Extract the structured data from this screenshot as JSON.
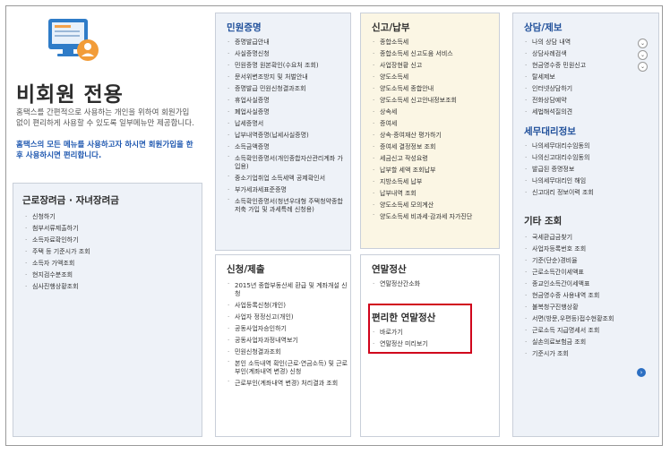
{
  "hero": {
    "title": "비회원 전용",
    "desc": "홈택스를 간편적으로 사용하는 개인을 위하여 회원가입 없이 편리하게 사용할 수 있도록 일부메뉴만 제공합니다.",
    "desc_link": "홈택스의 모든 메뉴를 사용하고자 하시면 회원가입을 한 후 사용하시면 편리합니다.",
    "icon": "computer-person-icon"
  },
  "earned": {
    "title": "근로장려금 · 자녀장려금",
    "items": [
      "신청하기",
      "첨부서류제출하기",
      "소득자료확인하기",
      "주택 등 기준시가 조회",
      "소득자 가액조회",
      "현지검수분조회",
      "심사진행상황조회"
    ]
  },
  "civil": {
    "title": "민원증명",
    "items": [
      "증명발급안내",
      "사실증명신청",
      "민원증명 원본확인(수요처 조회)",
      "문서위변조방지 및 처벌안내",
      "증명발급 민원신청결과조회",
      "휴업사실증명",
      "폐업사실증명",
      "납세증명서",
      "납부내역증명(납세사실증명)",
      "소득금액증명",
      "소득확인증명서(개인종합자산관리계좌 가입용)",
      "중소기업취업 소득세액 공제확인서",
      "부가세과세표준증명",
      "소득확인증명서(청년우대형 주택청약종합저축 가입 및 과세특례 신청용)"
    ]
  },
  "apply": {
    "title": "신청/제출",
    "items": [
      "2015년 종합부동산세 환급 및 계좌개설 신청",
      "사업등록신청(개인)",
      "사업자 정정신고(개인)",
      "공동사업자승인하기",
      "공동사업자과정내역보기",
      "민원신청결과조회",
      "본인 소득내역 확인(근로·연금소득) 및 근로부인(계좌내역 변경) 신청",
      "근로부인(계좌내역 변경) 처리결과 조회"
    ]
  },
  "report": {
    "title": "신고/납부",
    "items": [
      "종합소득세",
      "종합소득세 신고도움 서비스",
      "사업장현황 신고",
      "양도소득세",
      "양도소득세 종합안내",
      "양도소득세 신고안내정보조회",
      "상속세",
      "증여세",
      "상속·증여재산 평가하기",
      "증여세 결정정보 조회",
      "세금신고 작성요령",
      "납부할 세액 조회납부",
      "지방소득세 납부",
      "납부내역 조회",
      "양도소득세 모의계산",
      "양도소득세 비과세·감과세 자가진단"
    ]
  },
  "yearend": {
    "title": "연말정산",
    "items": [
      "연말정산간소화"
    ]
  },
  "easy_yearend": {
    "title": "편리한 연말정산",
    "items": [
      "바로가기",
      "연말정산 미리보기"
    ]
  },
  "consult": {
    "title": "상담/제보",
    "items": [
      {
        "label": "나의 상담 내역",
        "toggle": true
      },
      {
        "label": "상담사례검색",
        "toggle": true
      },
      {
        "label": "현금영수증 민원신고",
        "toggle": true
      },
      {
        "label": "탈세제보",
        "toggle": false
      },
      {
        "label": "인터넷상담하기",
        "toggle": false
      },
      {
        "label": "전화상담예약",
        "toggle": false
      },
      {
        "label": "세법해석질의견",
        "toggle": false
      }
    ],
    "toggle_glyph": "⌄"
  },
  "agent": {
    "title": "세무대리정보",
    "items": [
      "나의세무대리수임동의",
      "나의신고대리수임동의",
      "발급된 증명정보",
      "나의세무대리인 해임",
      "신고대리 정보이력 조회"
    ]
  },
  "other": {
    "title": "기타 조회",
    "items": [
      "국세환급금찾기",
      "사업자등록번호 조회",
      "기준(단순)경비율",
      "근로소득간이세액표",
      "종교인소득간이세액표",
      "현금영수증 사용내역 조회",
      "불복청구진행상황",
      "서면(방문,우편등)접수현황조회",
      "근로소득 지급명세서 조회",
      "실손의료보험금 조회",
      "기준시가 조회"
    ],
    "go_icon": "arrow-right-circle-icon"
  },
  "colors": {
    "accent": "#1f4f9a",
    "highlight": "#d0021b",
    "card_blue": "#eef2f8",
    "card_cream": "#fbf6e4"
  }
}
